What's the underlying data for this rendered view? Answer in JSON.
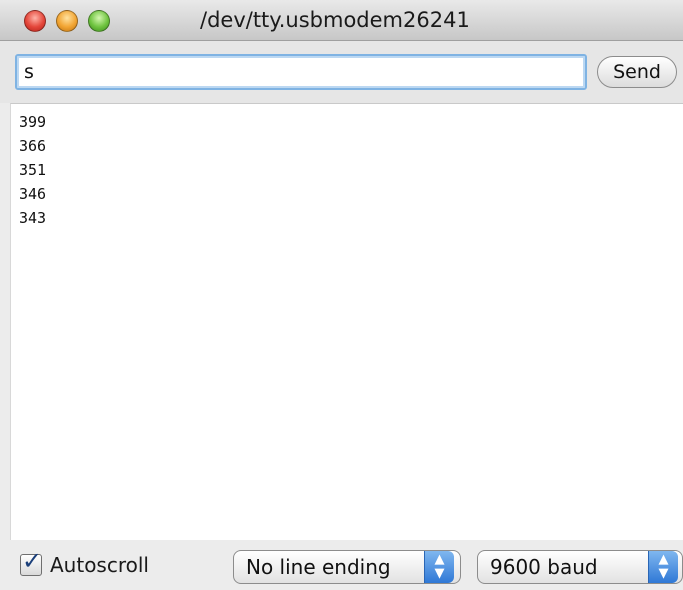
{
  "window": {
    "title": "/dev/tty.usbmodem26241"
  },
  "input": {
    "value": "s",
    "send_label": "Send"
  },
  "output": {
    "lines": [
      "399",
      "366",
      "351",
      "346",
      "343"
    ]
  },
  "bottom": {
    "autoscroll_label": "Autoscroll",
    "autoscroll_checked": true,
    "line_ending_selected": "No line ending",
    "baud_selected": "9600 baud"
  },
  "icons": {
    "close": "close-button-icon",
    "minimize": "minimize-button-icon",
    "zoom": "zoom-button-icon",
    "checkmark": "checkmark-icon",
    "select_arrows": "up-down-arrows-icon"
  },
  "colors": {
    "close": "#e4463a",
    "minimize": "#f2a533",
    "zoom": "#6fc440",
    "focus_ring": "#7fb3e3",
    "select_accent": "#2f78d6"
  }
}
